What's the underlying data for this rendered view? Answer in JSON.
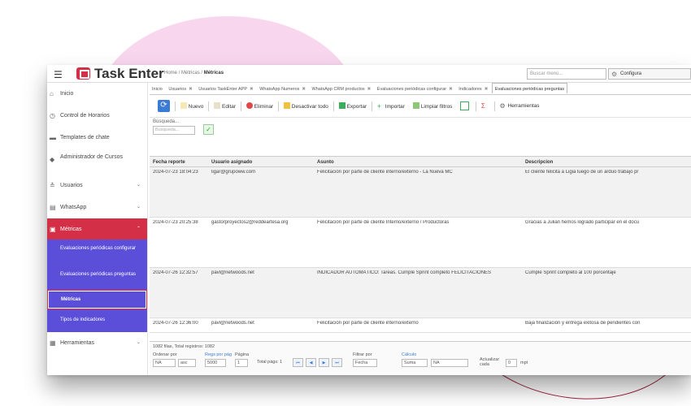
{
  "app": {
    "name": "Task Enter"
  },
  "breadcrumb": {
    "home": "Home",
    "section": "Métricas",
    "current": "Métricas"
  },
  "header": {
    "search_placeholder": "Buscar menú...",
    "config_label": "Configura"
  },
  "sidebar": {
    "items": [
      {
        "label": "Inicio",
        "icon": "home-icon"
      },
      {
        "label": "Control de Horarios",
        "icon": "clock-icon"
      },
      {
        "label": "Templates de chate",
        "icon": "chat-icon"
      },
      {
        "label": "Administrador de Cursos",
        "icon": "graduation-icon"
      },
      {
        "label": "Usuarios",
        "icon": "users-icon"
      },
      {
        "label": "WhatsApp",
        "icon": "whatsapp-icon"
      },
      {
        "label": "Métricas",
        "icon": "chart-icon"
      },
      {
        "label": "Herramientas",
        "icon": "tools-icon"
      }
    ],
    "subitems": [
      {
        "label": "Evaluaciones periódicas configurar"
      },
      {
        "label": "Evaluaciones periódicas preguntas"
      },
      {
        "label": "Métricas"
      },
      {
        "label": "Tipos de indicadores"
      }
    ]
  },
  "tabs": [
    {
      "label": "Inicio"
    },
    {
      "label": "Usuarios"
    },
    {
      "label": "Usuarios TaskEnter APP"
    },
    {
      "label": "WhatsApp Numeros"
    },
    {
      "label": "WhatsApp CRM productos"
    },
    {
      "label": "Evaluaciones periódicas configurar"
    },
    {
      "label": "Indicadores"
    },
    {
      "label": "Evaluaciones periódicas preguntas"
    }
  ],
  "toolbar": {
    "nuevo": "Nuevo",
    "editar": "Editar",
    "eliminar": "Eliminar",
    "desactivar": "Desactivar todo",
    "exportar": "Exportar",
    "importar": "Importar",
    "limpiar": "Limpiar filtros",
    "herramientas": "Herramientas"
  },
  "search": {
    "label": "Búsqueda...",
    "placeholder": "Búsqueda..."
  },
  "grid": {
    "columns": [
      "Fecha reporte",
      "Usuario asignado",
      "Asunto",
      "Descripcion"
    ],
    "rows": [
      [
        "2024-07-23 18:04:23",
        "ligar@grupoww.com",
        "Felicitación por parte de cliente interno/externo - La Nueva MC",
        "El cliente felicita a Ligia luego de un arduo trabajo pr"
      ],
      [
        "2024-07-23 20:25:38",
        "gastorproyectos2@reddeartesa.org",
        "Felicitación por parte de cliente Interno/externo / Productoras",
        "Gracias a Julian hemos logrado participar en el docu"
      ],
      [
        "2024-07-26 12:32:57",
        "pavl@netwoods.net",
        "INDICADOR AUTOMÁTICO: Tareas. Cumple Sprint completo FELICITACIONES",
        "Cumple Sprint completo al 100 porcentaje"
      ],
      [
        "2024-07-26 12:36:00",
        "pavl@netwoods.net",
        "Felicitación por parte de cliente interno/externo",
        "Baja finalización y entrega exitosa de pendientes con"
      ]
    ]
  },
  "footer": {
    "records": "1082 filas, Total registros: 1082",
    "ordenar_label": "Ordenar por",
    "ordenar_value": "NA",
    "dir_value": "asc",
    "regs_label": "Regs por pág",
    "regs_value": "5000",
    "pagina_label": "Página",
    "pagina_value": "1",
    "total_label": "Total págs: 1",
    "filtrar_label": "Filtrar por",
    "filtrar_value": "Fecha",
    "calculo_label": "Cálculo",
    "calculo_value": "Suma",
    "calculo_field": "NA",
    "actualizar_label": "Actualizar cada",
    "actualizar_value": "0",
    "actualizar_unit": "mpt"
  }
}
